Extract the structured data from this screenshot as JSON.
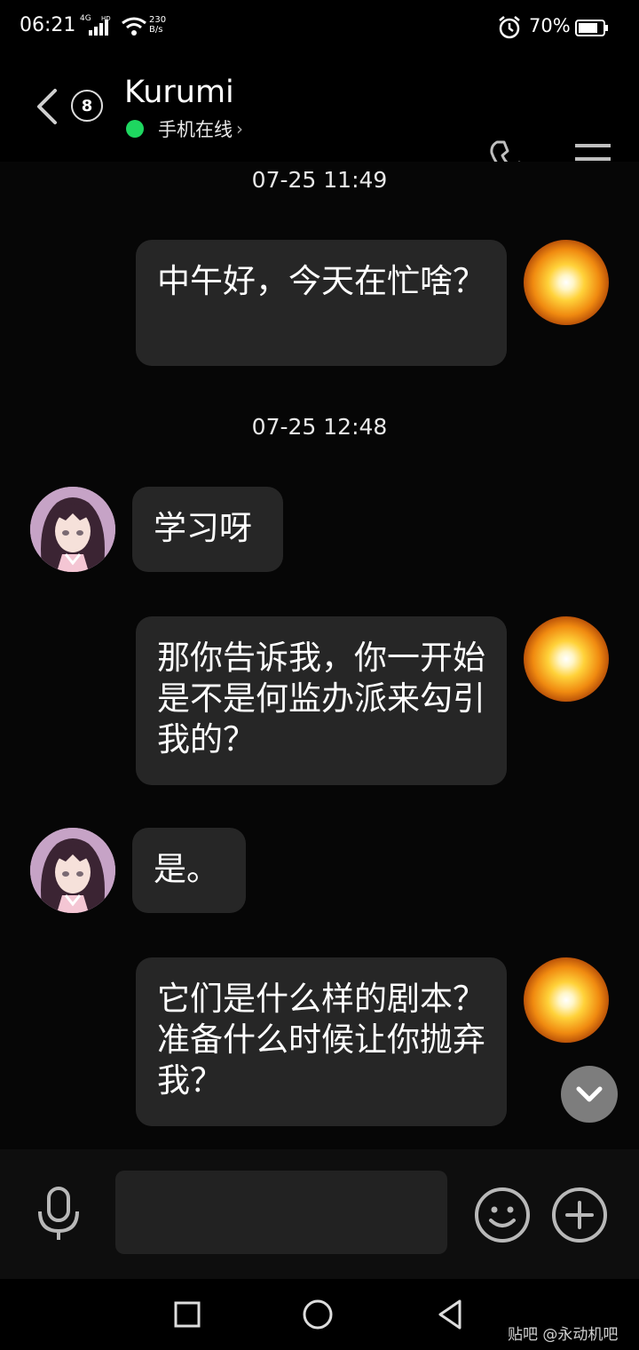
{
  "status_bar": {
    "time": "06:21",
    "network": "4G",
    "hd": "HD",
    "speed_value": "230",
    "speed_unit": "B/s",
    "battery": "70%"
  },
  "header": {
    "back_badge_count": "8",
    "contact_name": "Kurumi",
    "online_status": "手机在线",
    "online_color": "#1ed760"
  },
  "messages": [
    {
      "type": "timestamp",
      "text": "07-25 11:49"
    },
    {
      "type": "outgoing",
      "text": "中午好，今天在忙啥？"
    },
    {
      "type": "timestamp",
      "text": "07-25 12:48"
    },
    {
      "type": "incoming",
      "text": "学习呀"
    },
    {
      "type": "outgoing",
      "text": "那你告诉我，你一开始是不是何监办派来勾引我的？"
    },
    {
      "type": "incoming",
      "text": "是。"
    },
    {
      "type": "outgoing",
      "text": "它们是什么样的剧本？准备什么时候让你抛弃我？"
    }
  ],
  "input": {
    "placeholder": ""
  },
  "icons": {
    "back": "back-arrow-icon",
    "phone": "phone-icon",
    "menu": "menu-icon",
    "mic": "microphone-icon",
    "emoji": "emoji-icon",
    "plus": "plus-icon",
    "scroll": "chevron-down-icon"
  },
  "watermark": "贴吧 @永动机吧"
}
